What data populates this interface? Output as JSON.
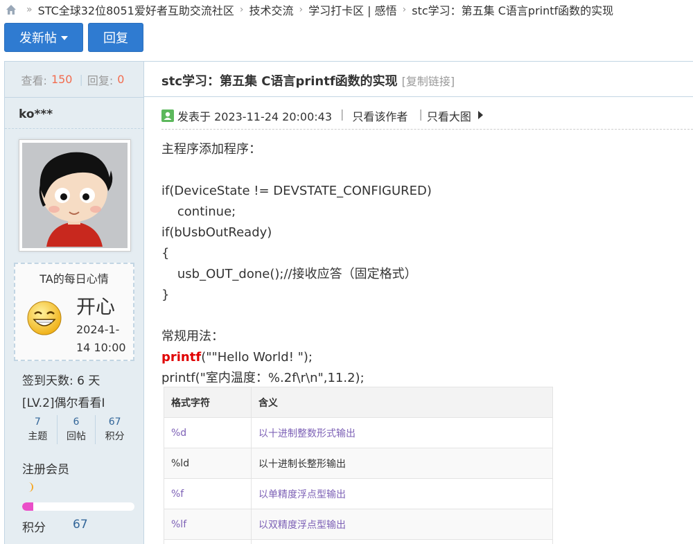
{
  "breadcrumb": {
    "items": [
      "STC全球32位8051爱好者互助交流社区",
      "技术交流",
      "学习打卡区 | 感悟",
      "stc学习：第五集 C语言printf函数的实现"
    ],
    "separator": "»"
  },
  "buttons": {
    "new_post": "发新帖",
    "reply": "回复"
  },
  "sidebar": {
    "views_label": "查看:",
    "views": "150",
    "replies_label": "回复:",
    "replies": "0",
    "author": "ko***",
    "mood_title": "TA的每日心情",
    "mood": "开心",
    "mood_date": "2024-1-14 10:00",
    "sign_days": "签到天数: 6 天",
    "level": "[LV.2]偶尔看看I",
    "mini_stats": [
      {
        "num": "7",
        "label": "主题"
      },
      {
        "num": "6",
        "label": "回帖"
      },
      {
        "num": "67",
        "label": "积分"
      }
    ],
    "member_group": "注册会员",
    "progress_fraction": 0.1,
    "points_label": "积分",
    "points": "67"
  },
  "post": {
    "title": "stc学习：第五集 C语言printf函数的实现",
    "copy_link": "[复制链接]",
    "posted_at": "发表于 2023-11-24 20:00:43",
    "only_author": "只看该作者",
    "only_large": "只看大图",
    "lines": [
      "主程序添加程序：",
      "",
      "if(DeviceState != DEVSTATE_CONFIGURED)",
      "    continue;",
      "if(bUsbOutReady)",
      "{",
      "    usb_OUT_done();//接收应答（固定格式）",
      "}",
      "",
      "常规用法：",
      "",
      "printf(\"室内温度：%.2f\\r\\n\",11.2);"
    ],
    "printf_keyword": "printf",
    "printf_rest": "(\"\"Hello World! \");"
  },
  "format_table": {
    "headers": [
      "格式字符",
      "含义"
    ],
    "rows": [
      {
        "code": "%d",
        "meaning": "以十进制整数形式输出"
      },
      {
        "code": "%ld",
        "meaning": "以十进制长整形输出"
      },
      {
        "code": "%f",
        "meaning": "以单精度浮点型输出"
      },
      {
        "code": "%lf",
        "meaning": "以双精度浮点型输出"
      },
      {
        "code": "",
        "meaning": ""
      }
    ]
  },
  "colors": {
    "accent": "#2f7bd1",
    "sidebar_bg": "#e5edf2",
    "count": "#f26c4f",
    "link": "#336699",
    "keyword": "#e00000"
  }
}
